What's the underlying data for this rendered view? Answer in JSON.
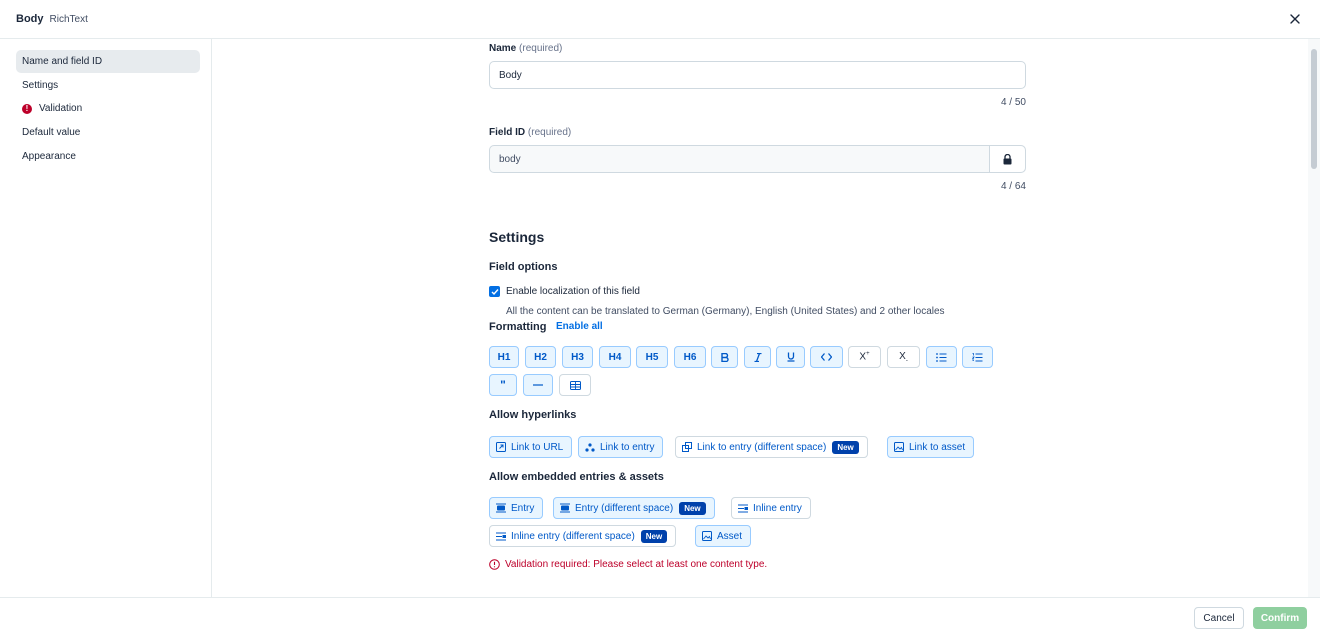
{
  "header": {
    "title": "Body",
    "subtitle": "RichText"
  },
  "sidebar": {
    "items": [
      {
        "label": "Name and field ID"
      },
      {
        "label": "Settings"
      },
      {
        "label": "Validation"
      },
      {
        "label": "Default value"
      },
      {
        "label": "Appearance"
      }
    ]
  },
  "name_field": {
    "label": "Name",
    "required": "(required)",
    "value": "Body",
    "counter": "4 / 50"
  },
  "id_field": {
    "label": "Field ID",
    "required": "(required)",
    "value": "body",
    "counter": "4 / 64"
  },
  "settings": {
    "heading": "Settings",
    "field_options": "Field options",
    "localization_label": "Enable localization of this field",
    "localization_help": "All the content can be translated to German (Germany), English (United States) and 2 other locales",
    "formatting": "Formatting",
    "enable_all": "Enable all",
    "format_buttons": [
      "H1",
      "H2",
      "H3",
      "H4",
      "H5",
      "H6"
    ],
    "hyperlinks_heading": "Allow hyperlinks",
    "hyperlinks": {
      "url": "Link to URL",
      "entry": "Link to entry",
      "entry_diff": "Link to entry (different space)",
      "asset": "Link to asset"
    },
    "embedded_heading": "Allow embedded entries & assets",
    "embedded": {
      "entry": "Entry",
      "entry_diff": "Entry (different space)",
      "inline": "Inline entry",
      "inline_diff": "Inline entry (different space)",
      "asset": "Asset"
    },
    "new_badge": "New",
    "validation_error": "Validation required: Please select at least one content type."
  },
  "footer": {
    "cancel": "Cancel",
    "confirm": "Confirm"
  },
  "colors": {
    "accent": "#036fe3",
    "error": "#bd002a",
    "confirm_disabled": "#8fcf9f"
  }
}
